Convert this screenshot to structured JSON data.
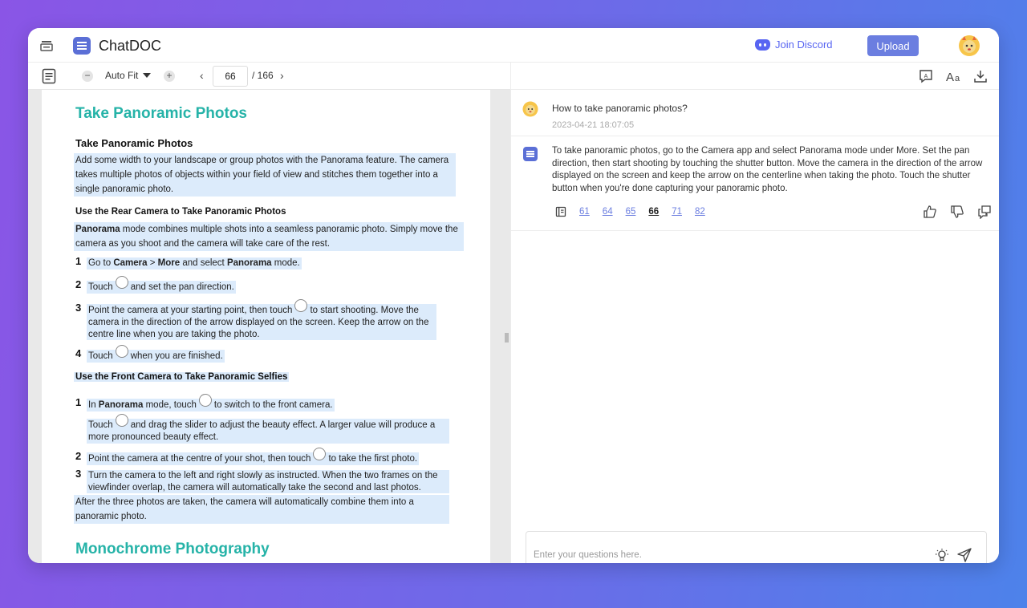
{
  "app": {
    "title": "ChatDOC"
  },
  "header": {
    "discord_label": "Join Discord",
    "upload_label": "Upload"
  },
  "pdf_toolbar": {
    "zoom": "Auto Fit",
    "current_page": "66",
    "total_pages": "/ 166"
  },
  "pdf": {
    "heading": "Take Panoramic Photos",
    "subheading": "Take Panoramic Photos",
    "intro": [
      "Add some width to your landscape or group photos with the Panorama feature. The camera",
      "takes multiple photos of objects within your field of view and stitches them together into a",
      "single panoramic photo."
    ],
    "rear_heading": "Use the Rear Camera to Take Panoramic Photos",
    "rear_intro_bold": "Panorama",
    "rear_intro_line1": " mode combines multiple shots into a seamless panoramic photo. Simply move the",
    "rear_intro_line2": "camera as you shoot and the camera will take care of the rest.",
    "rear_steps": [
      {
        "n": "1",
        "pre": "Go to ",
        "b1": "Camera",
        "mid1": " > ",
        "b2": "More",
        "mid2": " and select ",
        "b3": "Panorama",
        "post": " mode."
      },
      {
        "n": "2",
        "pre": "Touch",
        "post": "and set the pan direction."
      },
      {
        "n": "3",
        "pre": "Point the camera at your starting point, then touch",
        "post": "to start shooting. Move the",
        "l2": "camera in the direction of the arrow displayed on the screen. Keep the arrow on the",
        "l3": "centre line when you are taking the photo."
      },
      {
        "n": "4",
        "pre": "Touch",
        "post": "when you are finished."
      }
    ],
    "front_heading": "Use the Front Camera to Take Panoramic Selfies",
    "front_steps": [
      {
        "n": "1",
        "pre": "In ",
        "b": "Panorama",
        "mid": " mode, touch",
        "post": "to switch to the front camera."
      },
      {
        "pre": "Touch",
        "post": "and drag the slider to adjust the beauty effect. A larger value will produce a",
        "l2": "more pronounced beauty effect."
      },
      {
        "n": "2",
        "pre": "Point the camera at the centre of your shot, then touch",
        "post": "to take the first photo."
      },
      {
        "n": "3",
        "l1": "Turn the camera to the left and right slowly as instructed. When the two frames on the",
        "l2": "viewfinder overlap, the camera will automatically take the second and last photos."
      }
    ],
    "outro": [
      "After the three photos are taken, the camera will automatically combine them into a",
      "panoramic photo."
    ],
    "next_heading": "Monochrome Photography"
  },
  "chat": {
    "question": "How to take panoramic photos?",
    "question_time": "2023-04-21 18:07:05",
    "answer": "To take panoramic photos, go to the Camera app and select Panorama mode under More. Set the pan direction, then start shooting by touching the shutter button. Move the camera in the direction of the arrow displayed on the screen and keep the arrow on the centerline when taking the photo. Touch the shutter button when you're done capturing your panoramic photo.",
    "refs": [
      "61",
      "64",
      "65",
      "66",
      "71",
      "82"
    ],
    "active_ref": "66",
    "input_placeholder": "Enter your questions here."
  },
  "colors": {
    "accent": "#6b7ee0",
    "heading": "#26b3a8",
    "highlight": "#dcebfb",
    "discord": "#5865f2"
  }
}
